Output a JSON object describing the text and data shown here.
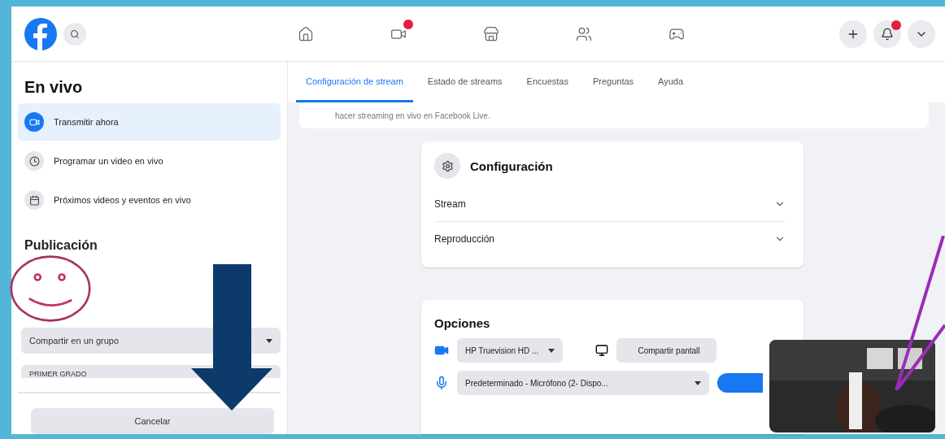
{
  "header": {
    "nav": [
      {
        "badge": false
      },
      {
        "badge": true
      },
      {
        "badge": false
      },
      {
        "badge": false
      },
      {
        "badge": false
      }
    ],
    "actions": [
      {
        "badge": false
      },
      {
        "badge": true
      },
      {
        "badge": false
      }
    ]
  },
  "sidebar": {
    "title": "En vivo",
    "items": [
      {
        "label": "Transmitir ahora",
        "selected": true
      },
      {
        "label": "Programar un video en vivo",
        "selected": false
      },
      {
        "label": "Próximos videos y eventos en vivo",
        "selected": false
      }
    ],
    "section": "Publicación",
    "selects": [
      "Compartir en un grupo",
      "PRIMER GRADO"
    ],
    "cancel": "Cancelar"
  },
  "tabs": [
    {
      "label": "Configuración de stream",
      "selected": true
    },
    {
      "label": "Estado de streams",
      "selected": false
    },
    {
      "label": "Encuestas",
      "selected": false
    },
    {
      "label": "Preguntas",
      "selected": false
    },
    {
      "label": "Ayuda",
      "selected": false
    }
  ],
  "intro": "hacer streaming en vivo en Facebook Live.",
  "settings": {
    "title": "Configuración",
    "rows": [
      {
        "label": "Stream",
        "expanded": false
      },
      {
        "label": "Reproducción",
        "expanded": false
      }
    ]
  },
  "options": {
    "title": "Opciones",
    "camera": "HP Truevision HD ...",
    "share": "Compartir pantall",
    "mic": "Predeterminado - Micrófono (2- Dispo..."
  }
}
